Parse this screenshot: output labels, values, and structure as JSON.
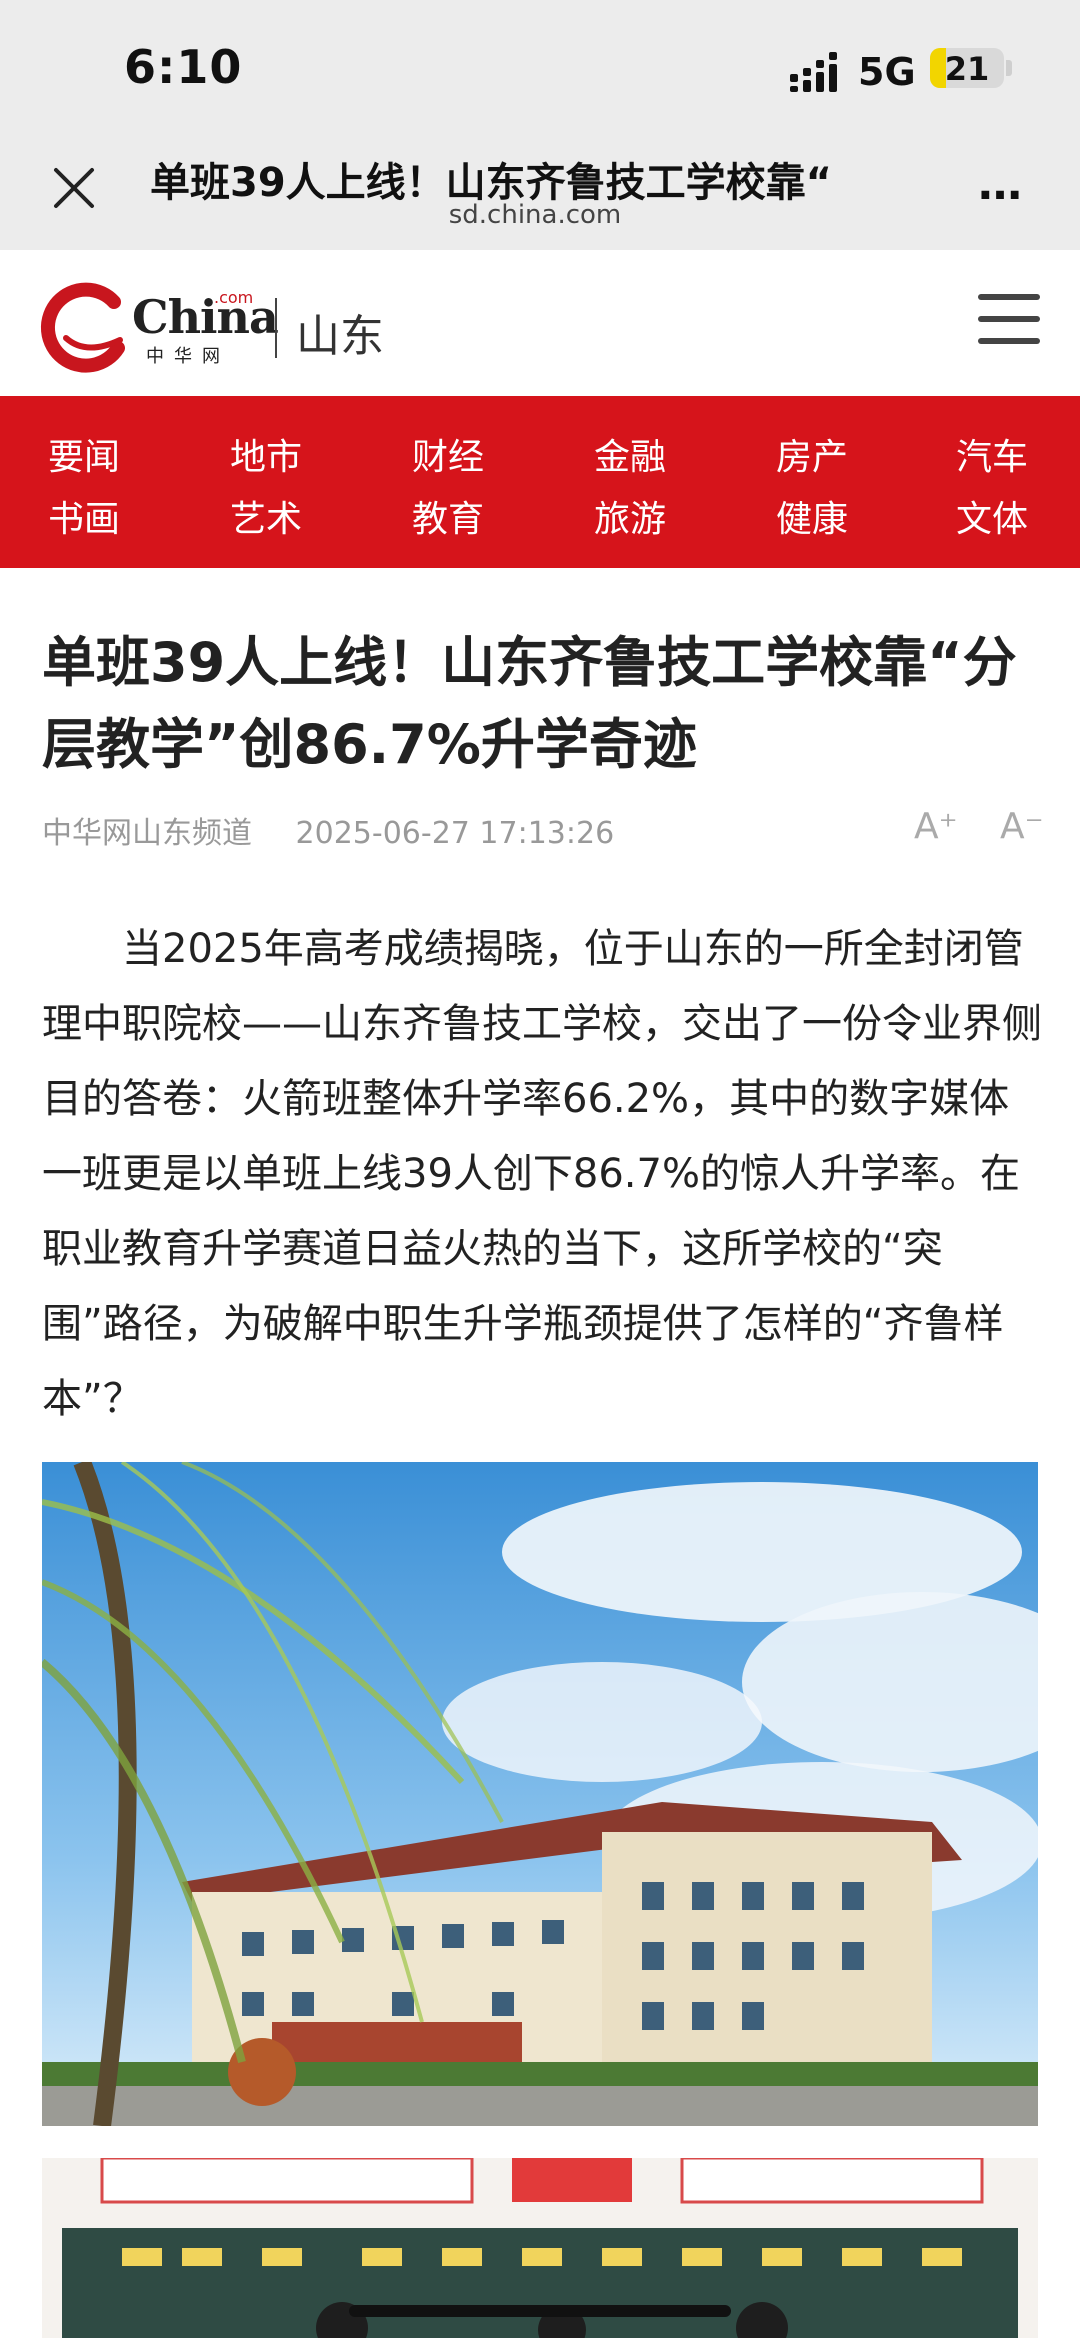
{
  "status_bar": {
    "time": "6:10",
    "network": "5G",
    "battery": "21",
    "battery_level": 0.21
  },
  "browser": {
    "title": "单班39人上线！山东齐鲁技工学校靠“",
    "url": "sd.china.com",
    "more": "…"
  },
  "site": {
    "logo_text": "China",
    "logo_com": ".com",
    "logo_cn": "中华网",
    "region": "山东"
  },
  "nav": {
    "row1": [
      "要闻",
      "地市",
      "财经",
      "金融",
      "房产",
      "汽车"
    ],
    "row2": [
      "书画",
      "艺术",
      "教育",
      "旅游",
      "健康",
      "文体"
    ]
  },
  "article": {
    "title": "单班39人上线！山东齐鲁技工学校靠“分层教学”创86.7%升学奇迹",
    "source": "中华网山东频道",
    "date": "2025-06-27 17:13:26",
    "font_up": "A⁺",
    "font_down": "A⁻",
    "body": "当2025年高考成绩揭晓，位于山东的一所全封闭管理中职院校——山东齐鲁技工学校，交出了一份令业界侧目的答卷：火箭班整体升学率66.2%，其中的数字媒体一班更是以单班上线39人创下86.7%的惊人升学率。在职业教育升学赛道日益火热的当下，这所学校的“突围”路径，为破解中职生升学瓶颈提供了怎样的“齐鲁样本”？"
  },
  "colors": {
    "brand_red": "#d6141b",
    "status_bg": "#ececec",
    "battery_yellow": "#f2d500"
  }
}
